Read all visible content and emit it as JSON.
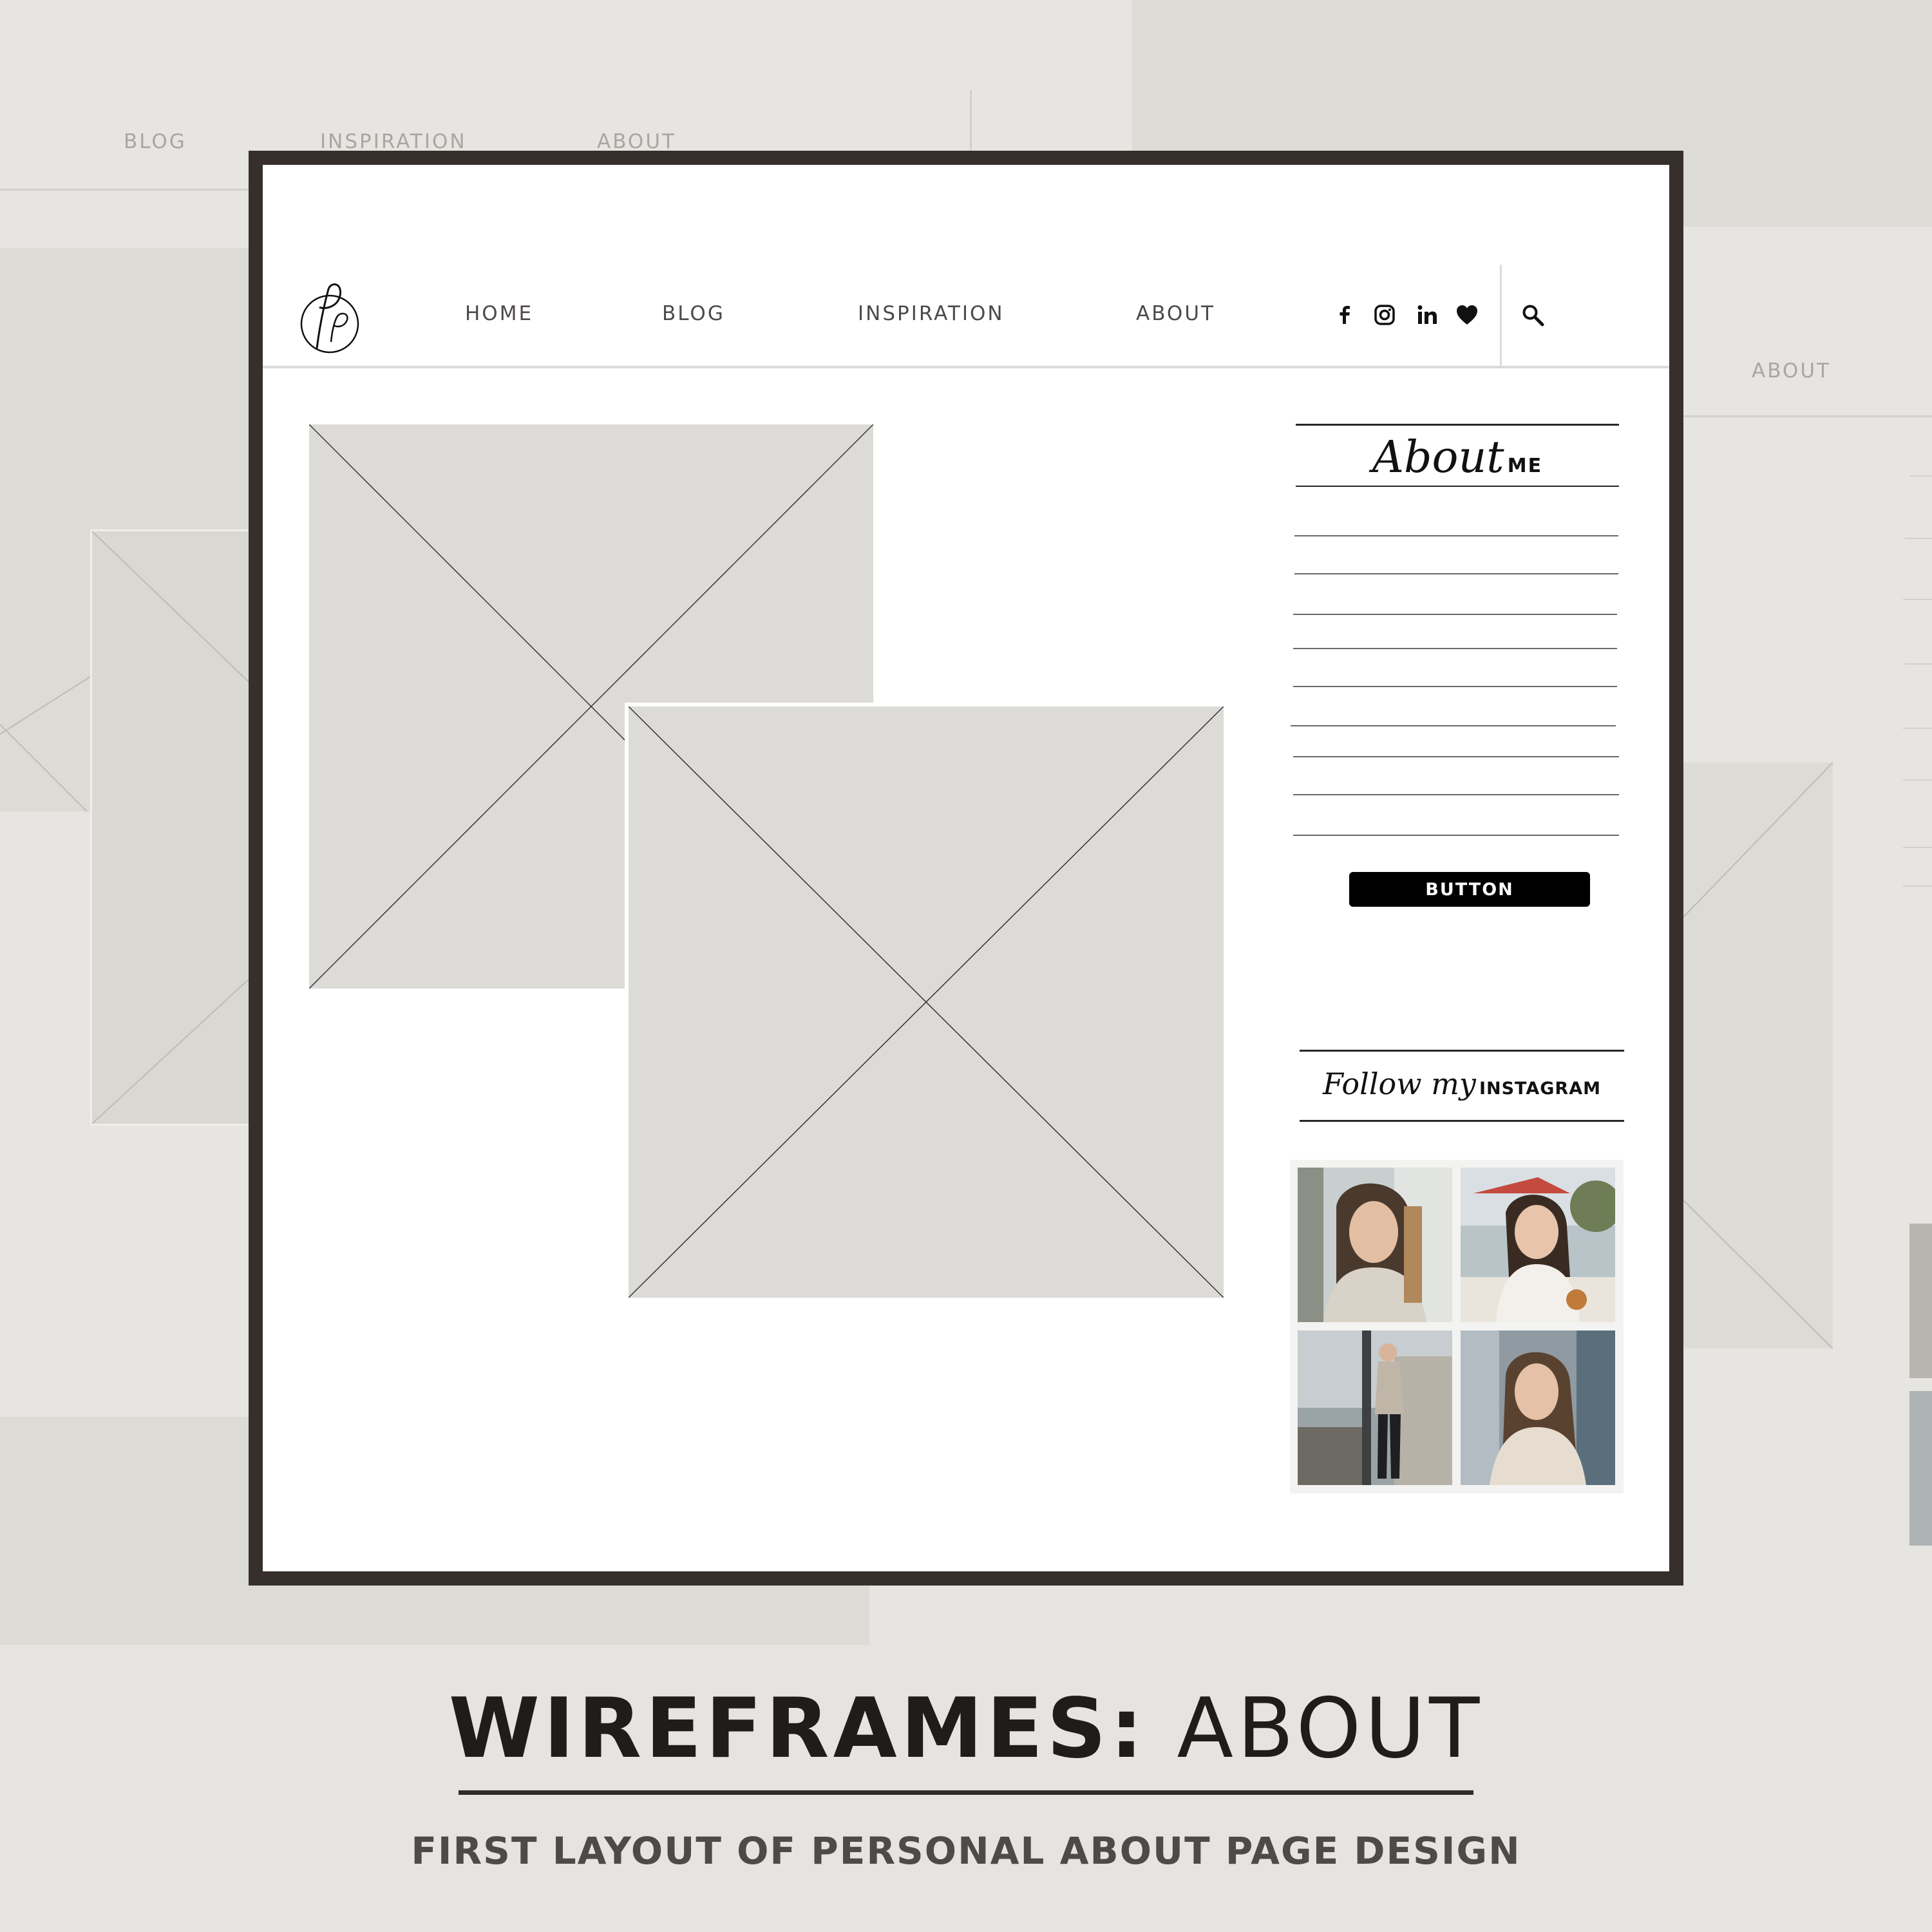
{
  "background_mock": {
    "nav_items": [
      "BLOG",
      "INSPIRATION",
      "ABOUT"
    ],
    "right_nav_item": "ABOUT"
  },
  "wireframe": {
    "logo": "Pp",
    "nav": {
      "items": [
        "HOME",
        "BLOG",
        "INSPIRATION",
        "ABOUT"
      ],
      "social_icons": [
        "facebook-icon",
        "instagram-icon",
        "linkedin-icon",
        "heart-icon"
      ],
      "search_icon": "search-icon"
    },
    "sidebar": {
      "about_script": "About",
      "about_caps": "ME",
      "button_label": "BUTTON",
      "follow_script": "Follow my",
      "follow_caps": "INSTAGRAM",
      "photos": [
        "instagram-photo-1",
        "instagram-photo-2",
        "instagram-photo-3",
        "instagram-photo-4"
      ]
    }
  },
  "caption": {
    "title_bold": "WIREFRAMES:",
    "title_light": "ABOUT",
    "subtitle": "FIRST LAYOUT OF PERSONAL ABOUT PAGE DESIGN"
  },
  "colors": {
    "frame_border": "#372f2c",
    "placeholder_fill": "#dcdbd7",
    "background": "#e5e4e0",
    "button_fill": "#000000"
  }
}
